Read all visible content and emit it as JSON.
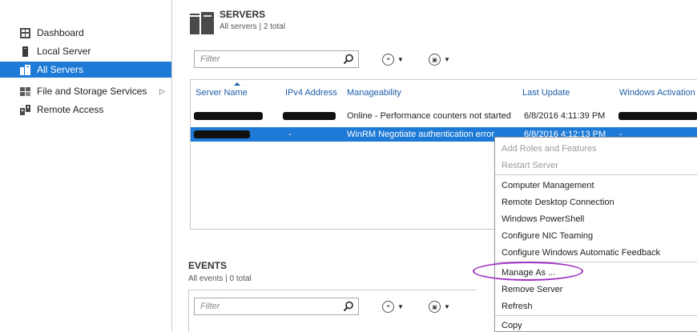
{
  "sidebar": {
    "items": [
      {
        "label": "Dashboard",
        "icon": "dashboard-icon"
      },
      {
        "label": "Local Server",
        "icon": "server-icon"
      },
      {
        "label": "All Servers",
        "icon": "servers-icon"
      },
      {
        "label": "File and Storage Services",
        "icon": "storage-icon"
      },
      {
        "label": "Remote Access",
        "icon": "remote-access-icon"
      }
    ]
  },
  "servers": {
    "title": "SERVERS",
    "subtitle": "All servers | 2 total",
    "filter_placeholder": "Filter",
    "columns": [
      "Server Name",
      "IPv4 Address",
      "Manageability",
      "Last Update",
      "Windows Activation"
    ],
    "rows": [
      {
        "manageability": "Online - Performance counters not started",
        "last_update": "6/8/2016 4:11:39 PM"
      },
      {
        "ipv4": "-",
        "manageability": "WinRM Negotiate authentication error",
        "last_update": "6/8/2016 4:12:13 PM",
        "activation": "-"
      }
    ]
  },
  "events": {
    "title": "EVENTS",
    "subtitle": "All events | 0 total",
    "filter_placeholder": "Filter"
  },
  "context_menu": {
    "items": [
      "Add Roles and Features",
      "Restart Server",
      "Computer Management",
      "Remote Desktop Connection",
      "Windows PowerShell",
      "Configure NIC Teaming",
      "Configure Windows Automatic Feedback",
      "Manage As ...",
      "Remove Server",
      "Refresh",
      "Copy"
    ]
  },
  "colors": {
    "selection": "#1e7ad7",
    "header_link": "#1e5fa8",
    "highlight": "#a02fc4"
  }
}
